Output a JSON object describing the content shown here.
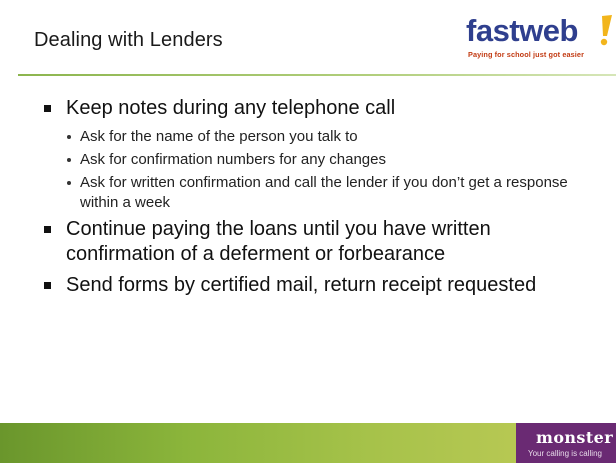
{
  "slide": {
    "title": "Dealing with Lenders"
  },
  "logo": {
    "fastweb_part1": "fast",
    "fastweb_part2": "web",
    "tagline": "Paying for school just got easier"
  },
  "bullets": [
    {
      "text": "Keep notes during any telephone call",
      "sub": [
        "Ask for the name of the person you talk to",
        "Ask for confirmation numbers for any changes",
        "Ask for written confirmation and call the lender if you don’t get a response within a week"
      ]
    },
    {
      "text": "Continue paying the loans until you have written confirmation of a deferment or forbearance",
      "sub": []
    },
    {
      "text": "Send forms by certified mail, return receipt requested",
      "sub": []
    }
  ],
  "footer": {
    "monster_word": "monster",
    "monster_tagline": "Your calling is calling"
  },
  "colors": {
    "fastweb_blue": "#2f3f8e",
    "fastweb_tag": "#c23a12",
    "footer_green": "#8bb53b",
    "monster_purple": "#6a2a73"
  }
}
